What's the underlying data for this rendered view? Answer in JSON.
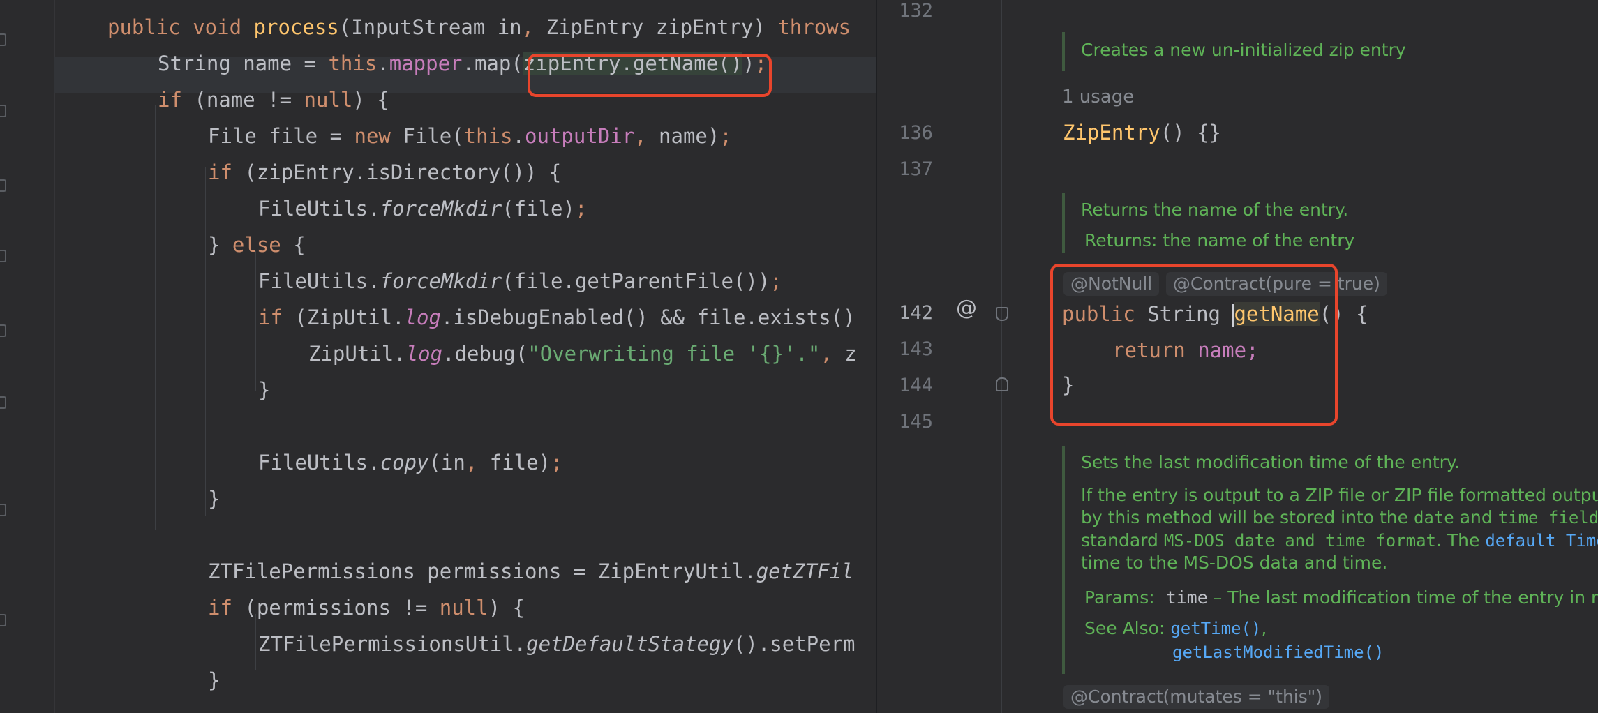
{
  "left_editor": {
    "lines": [
      [
        [
          "kw",
          "public "
        ],
        [
          "kw",
          "void "
        ],
        [
          "decl",
          "process"
        ],
        [
          "",
          "(InputStream in"
        ],
        [
          "kw",
          ", "
        ],
        [
          "",
          "ZipEntry zipEntry) "
        ],
        [
          "kw",
          "throws"
        ]
      ],
      [
        [
          "",
          "String name = "
        ],
        [
          "kw",
          "this"
        ],
        [
          "",
          "."
        ],
        [
          "fld",
          "mapper"
        ],
        [
          "",
          ".map("
        ],
        [
          "hl",
          "zipEntry.getName()"
        ],
        [
          "",
          ")"
        ],
        [
          "kw",
          ";"
        ]
      ],
      [
        [
          "kw",
          "if "
        ],
        [
          "",
          "(name != "
        ],
        [
          "kw",
          "null"
        ],
        [
          "",
          ") {"
        ]
      ],
      [
        [
          "",
          "File file = "
        ],
        [
          "kw",
          "new "
        ],
        [
          "",
          "File("
        ],
        [
          "kw",
          "this"
        ],
        [
          "",
          "."
        ],
        [
          "fld",
          "outputDir"
        ],
        [
          "kw",
          ", "
        ],
        [
          "",
          "name)"
        ],
        [
          "kw",
          ";"
        ]
      ],
      [
        [
          "kw",
          "if "
        ],
        [
          "",
          "(zipEntry.isDirectory()) {"
        ]
      ],
      [
        [
          "",
          "FileUtils."
        ],
        [
          "it",
          "forceMkdir"
        ],
        [
          "",
          "(file)"
        ],
        [
          "kw",
          ";"
        ]
      ],
      [
        [
          "",
          "} "
        ],
        [
          "kw",
          "else "
        ],
        [
          "",
          "{"
        ]
      ],
      [
        [
          "",
          "FileUtils."
        ],
        [
          "it",
          "forceMkdir"
        ],
        [
          "",
          "(file.getParentFile())"
        ],
        [
          "kw",
          ";"
        ]
      ],
      [
        [
          "kw",
          "if "
        ],
        [
          "",
          "(ZipUtil."
        ],
        [
          "itf",
          "log"
        ],
        [
          "",
          ".isDebugEnabled() && file.exists()"
        ]
      ],
      [
        [
          "",
          "ZipUtil."
        ],
        [
          "itf",
          "log"
        ],
        [
          "",
          ".debug("
        ],
        [
          "str",
          "\"Overwriting file '{}'.\""
        ],
        [
          "kw",
          ", "
        ],
        [
          "",
          "z"
        ]
      ],
      [
        [
          "",
          "}"
        ]
      ],
      [
        [
          "",
          ""
        ]
      ],
      [
        [
          "",
          "FileUtils."
        ],
        [
          "it",
          "copy"
        ],
        [
          "",
          "(in"
        ],
        [
          "kw",
          ", "
        ],
        [
          "",
          "file)"
        ],
        [
          "kw",
          ";"
        ]
      ],
      [
        [
          "",
          "}"
        ]
      ],
      [
        [
          "",
          ""
        ]
      ],
      [
        [
          "",
          "ZTFilePermissions permissions = ZipEntryUtil."
        ],
        [
          "it",
          "getZTFil"
        ]
      ],
      [
        [
          "kw",
          "if "
        ],
        [
          "",
          "(permissions != "
        ],
        [
          "kw",
          "null"
        ],
        [
          "",
          ") {"
        ]
      ],
      [
        [
          "",
          "ZTFilePermissionsUtil."
        ],
        [
          "it",
          "getDefaultStategy"
        ],
        [
          "",
          "().setPerm"
        ]
      ],
      [
        [
          "",
          "}"
        ]
      ]
    ]
  },
  "popup": {
    "line_numbers": [
      "132",
      "136",
      "137",
      "142",
      "143",
      "144",
      "145"
    ],
    "doc1": "Creates a new un-initialized zip entry",
    "usage": "1 usage",
    "ctor": "ZipEntry",
    "ctor_rest": "() {}",
    "doc2_line1": "Returns the name of the entry.",
    "doc2_line2": "Returns: the name of the entry",
    "anno_notnull": "@NotNull",
    "anno_contract": "@Contract(pure = true)",
    "method_kw": "public",
    "method_type": " String ",
    "method_name": "getName",
    "method_rest": "() {",
    "return_kw": "return",
    "return_val": " name;",
    "close_brace": "}",
    "gutter_at": "@",
    "doc3_title": "Sets the last modification time of the entry.",
    "doc3_p1": "If the entry is output to a ZIP file or ZIP file formatted outpu",
    "doc3_p2a": "by this method will be stored into the ",
    "doc3_p2b": "date",
    "doc3_p2c": " and ",
    "doc3_p2d": "time field",
    "doc3_p3a": "standard ",
    "doc3_p3b": "MS-DOS date and time format",
    "doc3_p3c": ". The ",
    "doc3_p3d": "default Time",
    "doc3_p4": "time to the MS-DOS data and time.",
    "params_label": "Params:",
    "params_name": "time",
    "params_desc": " – The last modification time of the entry in m",
    "see_also_label": "See Also:",
    "see_also_1": "getTime()",
    "see_also_sep": ",",
    "see_also_2": "getLastModifiedTime()",
    "anno_mutates": "@Contract(mutates = \"this\")"
  },
  "colors": {
    "background": "#2b2b2d",
    "keyword": "#cf8e6d",
    "field": "#c77dbb",
    "string": "#6aab73",
    "declaration": "#ffc66d",
    "doc_comment": "#5fb357",
    "highlight_box": "#e8452c"
  }
}
